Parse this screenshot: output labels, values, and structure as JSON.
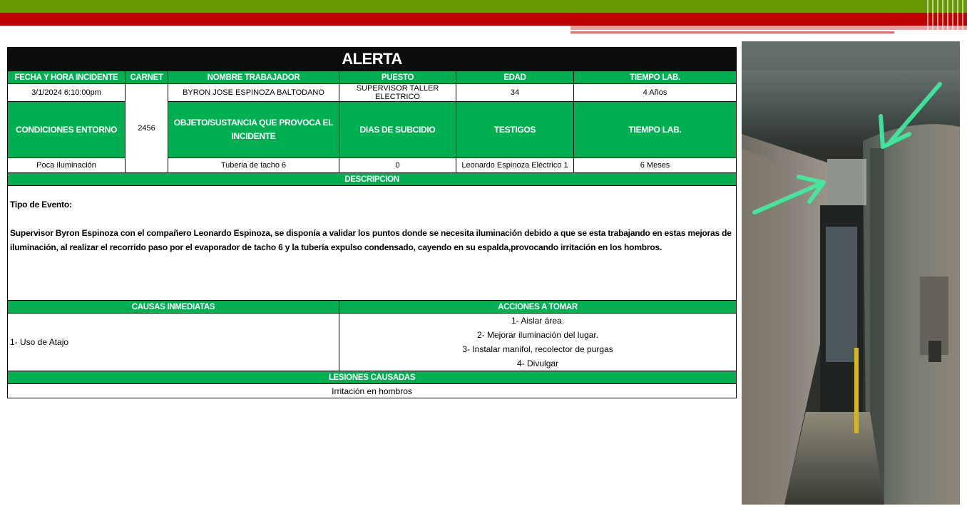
{
  "form": {
    "title": "ALERTA",
    "headers": {
      "fecha": "FECHA Y HORA INCIDENTE",
      "carnet": "CARNET",
      "nombre": "NOMBRE TRABAJADOR",
      "puesto": "PUESTO",
      "edad": "EDAD",
      "tiempo_lab": "TIEMPO LAB."
    },
    "row1": {
      "fecha": "3/1/2024  6:10:00pm",
      "carnet": "2456",
      "nombre": "BYRON JOSE ESPINOZA BALTODANO",
      "puesto": "SUPERVISOR TALLER ELECTRICO",
      "edad": "34",
      "tiempo_lab": "4 Años"
    },
    "headers2": {
      "condiciones": "CONDICIONES ENTORNO",
      "objeto": "OBJETO/SUSTANCIA QUE PROVOCA EL INCIDENTE",
      "dias": "DIAS DE SUBCIDIO",
      "testigos": "TESTIGOS",
      "tiempo_lab": "TIEMPO LAB."
    },
    "row2": {
      "condiciones": "Poca Iluminación",
      "objeto": "Tuberia de tacho 6",
      "dias": "0",
      "testigos": "Leonardo Espinoza Eléctrico 1",
      "tiempo_lab": "6 Meses"
    },
    "descripcion_header": "DESCRIPCION",
    "descripcion": {
      "tipo": "Tipo de Evento:",
      "texto": "Supervisor Byron Espinoza con el compañero Leonardo Espinoza, se disponía a validar los puntos donde se necesita iluminación debido a que se esta trabajando en estas mejoras de iluminación, al realizar el recorrido paso por el evaporador de tacho 6 y la tubería expulso condensado, cayendo en su espalda,provocando irritación en los hombros."
    },
    "causas_header": "CAUSAS INMEDIATAS",
    "acciones_header": "ACCIONES A TOMAR",
    "causas": "1- Uso de Atajo",
    "acciones": [
      "1- Aislar área.",
      "2- Mejorar iluminación del lugar.",
      "3- Instalar manifol, recolector de purgas",
      "4- Divulgar"
    ],
    "lesiones_header": "LESIONES CAUSADAS",
    "lesiones": "Irritación en hombros"
  },
  "colors": {
    "header_green": "#00b050",
    "title_black": "#0d0d0d",
    "band_green": "#669900",
    "band_red": "#c00000",
    "arrow": "#3ef0a0"
  },
  "photo": {
    "icon": "incident-photo-with-arrows"
  }
}
